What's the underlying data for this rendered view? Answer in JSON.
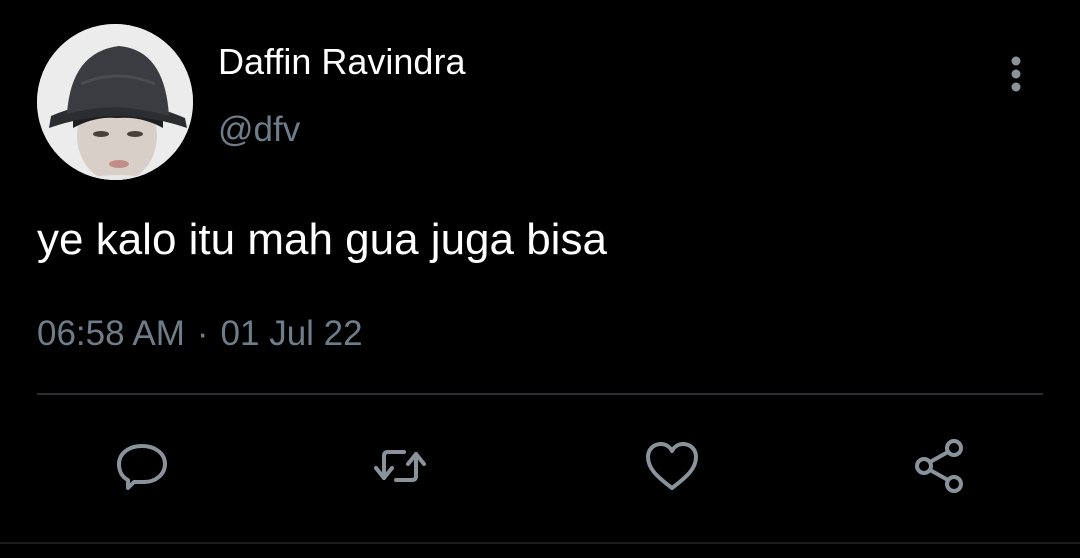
{
  "user": {
    "display_name": "Daffin Ravindra",
    "handle": "@dfv",
    "avatar_alt": "profile photo"
  },
  "tweet": {
    "text": "ye kalo itu mah gua juga bisa",
    "time": "06:58 AM",
    "separator": "·",
    "date": "01 Jul 22"
  },
  "actions": {
    "reply_icon": "reply-icon",
    "retweet_icon": "retweet-icon",
    "like_icon": "heart-icon",
    "share_icon": "share-icon",
    "more_icon": "more-vertical-icon"
  },
  "colors": {
    "background": "#000000",
    "primary_text": "#ffffff",
    "secondary_text": "#6f7d8b",
    "divider": "#2b2f33"
  }
}
